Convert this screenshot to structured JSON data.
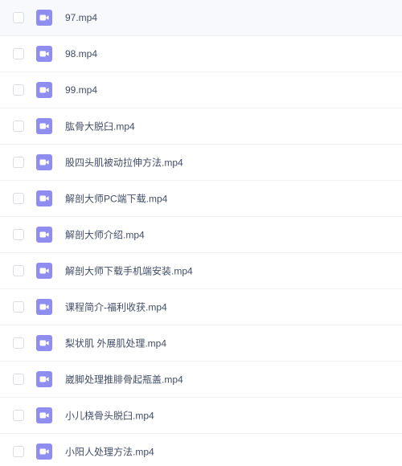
{
  "colors": {
    "icon_background": "#8f8ef0",
    "icon_glyph": "#ffffff",
    "text": "#424e67",
    "row_divider": "#eef0f4",
    "checkbox_border": "#d9dce1"
  },
  "icon": "video-file-icon",
  "files": [
    {
      "name": "97.mp4"
    },
    {
      "name": "98.mp4"
    },
    {
      "name": "99.mp4"
    },
    {
      "name": "肱骨大脱臼.mp4"
    },
    {
      "name": "股四头肌被动拉伸方法.mp4"
    },
    {
      "name": "解剖大师PC端下载.mp4"
    },
    {
      "name": "解剖大师介绍.mp4"
    },
    {
      "name": "解剖大师下载手机端安装.mp4"
    },
    {
      "name": "课程简介-福利收获.mp4"
    },
    {
      "name": "梨状肌 外展肌处理.mp4"
    },
    {
      "name": "崴脚处理推腓骨起瓶盖.mp4"
    },
    {
      "name": "小儿桡骨头脱臼.mp4"
    },
    {
      "name": "小阳人处理方法.mp4"
    }
  ]
}
